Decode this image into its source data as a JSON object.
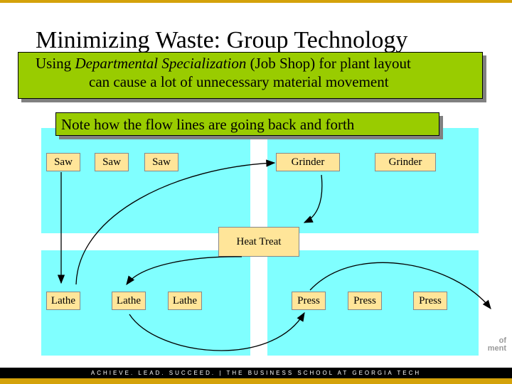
{
  "title": "Minimizing Waste: Group Technology",
  "subtitle": {
    "pre": "Using ",
    "italic": "Departmental Specialization",
    "post": " (Job Shop) for plant layout",
    "line2": "can cause a lot of unnecessary material movement"
  },
  "note": "Note how the flow lines are going back and forth",
  "machines": {
    "saw1": "Saw",
    "saw2": "Saw",
    "saw3": "Saw",
    "grinder1": "Grinder",
    "grinder2": "Grinder",
    "heat": "Heat Treat",
    "lathe1": "Lathe",
    "lathe2": "Lathe",
    "lathe3": "Lathe",
    "press1": "Press",
    "press2": "Press",
    "press3": "Press"
  },
  "logo": "of\nment",
  "footer": "ACHIEVE. LEAD. SUCCEED.  |  THE BUSINESS SCHOOL  AT GEORGIA TECH",
  "colors": {
    "accent_gold": "#d4a20a",
    "box_green": "#99cc00",
    "department_cyan": "#80ffff",
    "machine_fill": "#ffe599"
  }
}
